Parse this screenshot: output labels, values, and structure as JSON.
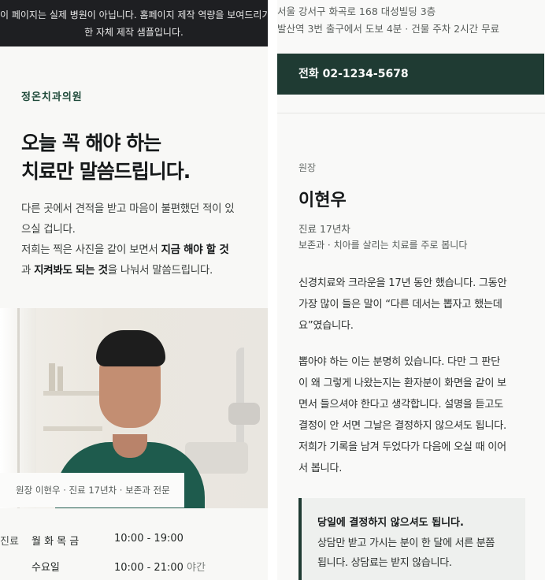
{
  "left": {
    "notice_lines": [
      "이 페이지는 실제 병원이 아닙니다. 홈페이지 제작 역량을 보여드리기 위",
      "한 자체 제작 샘플입니다."
    ],
    "brand": "정온치과의원",
    "headline_lines": [
      "오늘 꼭 해야 하는",
      "치료만 말씀드립니다."
    ],
    "intro": {
      "line1": "다른 곳에서 견적을 받고 마음이 불편했던 적이 있",
      "line2": "으실 겁니다.",
      "line3_pre": "저희는 찍은 사진을 같이 보면서 ",
      "line3_bold": "지금 해야 할 것",
      "line4_pre": "과 ",
      "line4_bold": "지켜봐도 되는 것",
      "line4_post": "을 나눠서 말씀드립니다."
    },
    "photo_caption": "원장 이현우 · 진료 17년차 · 보존과 전문",
    "hours": [
      {
        "label": "진료",
        "days": "월 화 목 금",
        "time": "10:00 - 19:00",
        "note": ""
      },
      {
        "label": "",
        "days": "수요일",
        "time": "10:00 - 21:00",
        "note": "야간"
      }
    ]
  },
  "right": {
    "address_lines": [
      "서울 강서구 화곡로 168 대성빌딩 3층",
      "발산역 3번 출구에서 도보 4분 · 건물 주차 2시간 무료"
    ],
    "call_button": "전화 02-1234-5678",
    "role": "원장",
    "doctor_name": "이현우",
    "years": "진료 17년차",
    "specialty": "보존과 · 치아를 살리는 치료를 주로 봅니다",
    "paragraph1": [
      "신경치료와 크라운을 17년 동안 했습니다. 그동안",
      "가장 많이 들은 말이 “다른 데서는 뽑자고 했는데",
      "요”였습니다."
    ],
    "paragraph2": [
      "뽑아야 하는 이는 분명히 있습니다. 다만 그 판단",
      "이 왜 그렇게 나왔는지는 환자분이 화면을 같이 보",
      "면서 들으셔야 한다고 생각합니다. 설명을 듣고도",
      "결정이 안 서면 그날은 결정하지 않으셔도 됩니다.",
      "저희가 기록을 남겨 두었다가 다음에 오실 때 이어",
      "서 봅니다."
    ],
    "callout": {
      "title": "당일에 결정하지 않으셔도 됩니다.",
      "body": [
        "상담만 받고 가시는 분이 한 달에 서른 분쯤",
        "됩니다. 상담료는 받지 않습니다."
      ]
    }
  },
  "colors": {
    "brand_green": "#1f3b33",
    "notice_bg": "#1e1f22"
  }
}
